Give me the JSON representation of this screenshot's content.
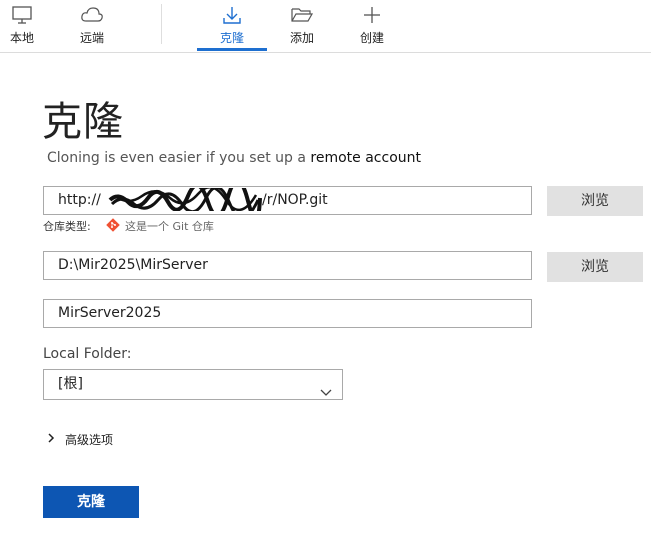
{
  "toolbar": {
    "items": [
      {
        "label": "本地",
        "icon": "monitor-icon"
      },
      {
        "label": "远端",
        "icon": "cloud-icon"
      },
      {
        "label": "克隆",
        "icon": "download-icon",
        "active": true
      },
      {
        "label": "添加",
        "icon": "folder-open-icon"
      },
      {
        "label": "创建",
        "icon": "plus-icon"
      }
    ]
  },
  "page": {
    "title": "克隆",
    "subtitle_prefix": "Cloning is even easier if you set up a",
    "subtitle_link": "remote account"
  },
  "url_field": {
    "value_prefix": "http://",
    "value_suffix": "/r/NOP.git"
  },
  "browse_label_1": "浏览",
  "browse_label_2": "浏览",
  "repo_type": {
    "label": "仓库类型:",
    "hint": "这是一个 Git 仓库",
    "icon": "git-icon"
  },
  "path_field": {
    "value": "D:\\Mir2025\\MirServer"
  },
  "name_field": {
    "value": "MirServer2025"
  },
  "local_folder": {
    "label": "Local Folder:",
    "selected": "[根]"
  },
  "advanced": {
    "label": "高级选项"
  },
  "clone_button": {
    "label": "克隆"
  },
  "colors": {
    "accent": "#1e6fd0",
    "primary_button": "#0d56b3",
    "git": "#f05133"
  }
}
